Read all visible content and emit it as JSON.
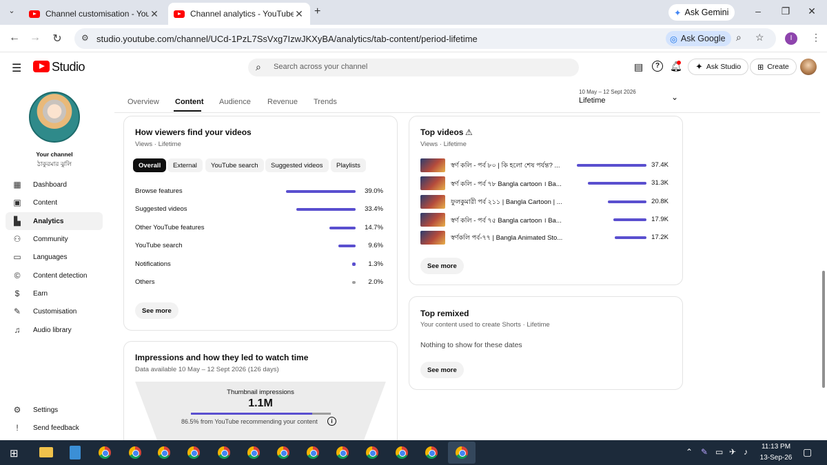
{
  "browser": {
    "tabs": [
      {
        "title": "Channel customisation - YouTube Studio",
        "active": false
      },
      {
        "title": "Channel analytics - YouTube Studio",
        "active": true
      }
    ],
    "new_tab": "+",
    "ask_gemini": "Ask Gemini",
    "url": "studio.youtube.com/channel/UCd-1PzL7SsVxg7IzwJKXyBA/analytics/tab-content/period-lifetime",
    "ask_google": "Ask Google",
    "profile_initial": "I"
  },
  "header": {
    "logo_text": "Studio",
    "search_placeholder": "Search across your channel",
    "ask_studio": "Ask Studio",
    "create": "Create"
  },
  "sidebar": {
    "your_channel": "Your channel",
    "channel_name": "ঠাকুরমার ঝুলি",
    "items": [
      {
        "label": "Dashboard",
        "icon": "dashboard-icon"
      },
      {
        "label": "Content",
        "icon": "content-icon"
      },
      {
        "label": "Analytics",
        "icon": "analytics-icon",
        "selected": true
      },
      {
        "label": "Community",
        "icon": "community-icon"
      },
      {
        "label": "Languages",
        "icon": "languages-icon"
      },
      {
        "label": "Content detection",
        "icon": "copyright-icon"
      },
      {
        "label": "Earn",
        "icon": "earn-icon"
      },
      {
        "label": "Customisation",
        "icon": "customisation-icon"
      },
      {
        "label": "Audio library",
        "icon": "audio-library-icon"
      }
    ],
    "bottom": [
      {
        "label": "Settings",
        "icon": "settings-icon"
      },
      {
        "label": "Send feedback",
        "icon": "feedback-icon"
      }
    ]
  },
  "analytics": {
    "tabs": [
      "Overview",
      "Content",
      "Audience",
      "Revenue",
      "Trends"
    ],
    "selected_tab": "Content",
    "period_range": "10 May – 12 Sept 2026",
    "period_label": "Lifetime"
  },
  "how_viewers": {
    "title": "How viewers find your videos",
    "subtitle": "Views · Lifetime",
    "chips": [
      "Overall",
      "External",
      "YouTube search",
      "Suggested videos",
      "Playlists"
    ],
    "rows": [
      {
        "label": "Browse features",
        "value": "39.0%",
        "fraction": 0.39,
        "color": "#5a4fcf"
      },
      {
        "label": "Suggested videos",
        "value": "33.4%",
        "fraction": 0.334,
        "color": "#5a4fcf"
      },
      {
        "label": "Other YouTube features",
        "value": "14.7%",
        "fraction": 0.147,
        "color": "#5a4fcf"
      },
      {
        "label": "YouTube search",
        "value": "9.6%",
        "fraction": 0.096,
        "color": "#5a4fcf"
      },
      {
        "label": "Notifications",
        "value": "1.3%",
        "fraction": 0.013,
        "color": "#5a4fcf"
      },
      {
        "label": "Others",
        "value": "2.0%",
        "fraction": 0.02,
        "color": "#9e9e9e"
      }
    ],
    "see_more": "See more"
  },
  "top_videos": {
    "title": "Top videos",
    "subtitle": "Views · Lifetime",
    "rows": [
      {
        "title": "স্বর্ণ কলি - পর্ব ৮০ | কি হলো শেষ পর্যন্ত? ...",
        "value": "37.4K",
        "fraction": 1.0
      },
      {
        "title": "স্বর্ণ কলি - পর্ব ৭৮ Bangla cartoon । Ba...",
        "value": "31.3K",
        "fraction": 0.837
      },
      {
        "title": "ফুলকুমারী পর্ব ২১১ | Bangla Cartoon | ...",
        "value": "20.8K",
        "fraction": 0.556
      },
      {
        "title": "স্বর্ণ কলি - পর্ব ৭৫ Bangla cartoon । Ba...",
        "value": "17.9K",
        "fraction": 0.479
      },
      {
        "title": "স্বর্ণকলি পর্ব-৭৭ | Bangla Animated Sto...",
        "value": "17.2K",
        "fraction": 0.46
      }
    ],
    "see_more": "See more"
  },
  "top_remixed": {
    "title": "Top remixed",
    "subtitle": "Your content used to create Shorts · Lifetime",
    "empty": "Nothing to show for these dates",
    "see_more": "See more"
  },
  "impressions": {
    "title": "Impressions and how they led to watch time",
    "subtitle": "Data available 10 May – 12 Sept 2026 (126 days)",
    "label": "Thumbnail impressions",
    "value": "1.1M",
    "recommend_fraction": 0.865,
    "note": "86.5% from YouTube recommending your content"
  },
  "taskbar": {
    "time": "11:13 PM",
    "date": "13-Sep-26"
  },
  "colors": {
    "accent": "#5a4fcf",
    "brand_red": "#ff0000"
  }
}
